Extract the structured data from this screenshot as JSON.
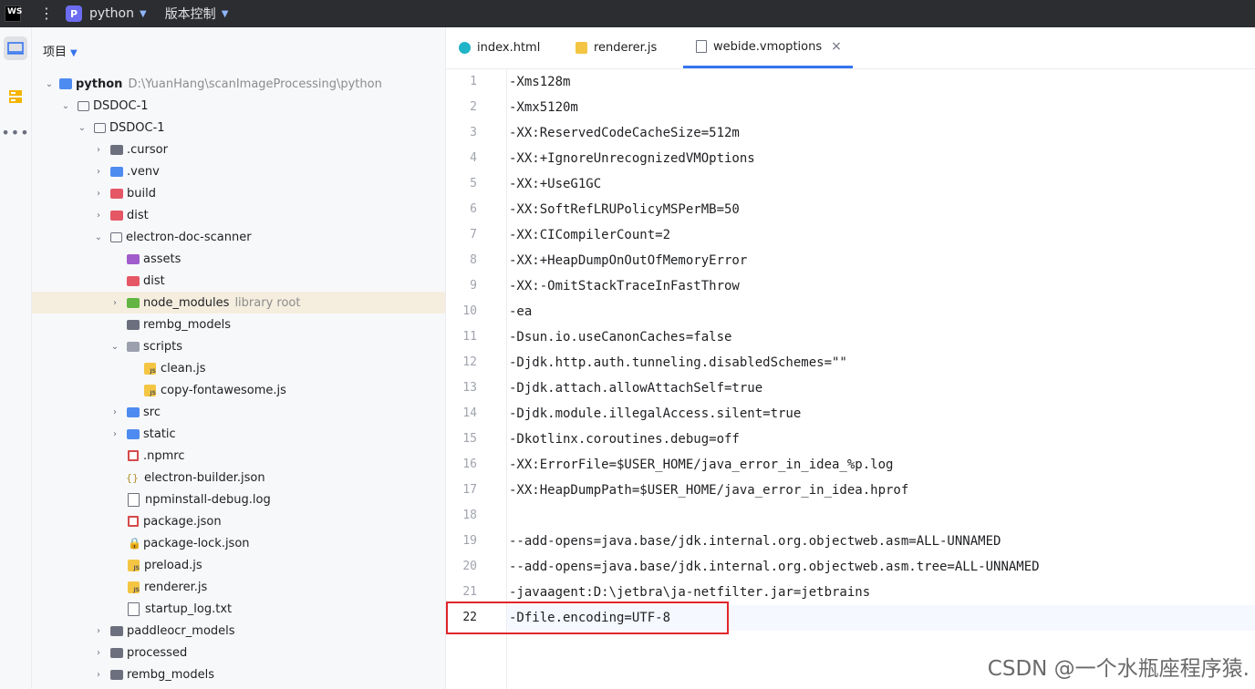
{
  "titlebar": {
    "logo_text": "WS",
    "project_badge": "P",
    "project_name": "python",
    "vcs_label": "版本控制"
  },
  "panel": {
    "title": "项目",
    "tree": [
      {
        "label": "python",
        "hint": "D:\\YuanHang\\scanImageProcessing\\python",
        "bold": true
      },
      {
        "label": "DSDOC-1",
        "hint": ""
      },
      {
        "label": "DSDOC-1",
        "hint": ""
      },
      {
        "label": ".cursor",
        "hint": ""
      },
      {
        "label": ".venv",
        "hint": ""
      },
      {
        "label": "build",
        "hint": ""
      },
      {
        "label": "dist",
        "hint": ""
      },
      {
        "label": "electron-doc-scanner",
        "hint": ""
      },
      {
        "label": "assets",
        "hint": ""
      },
      {
        "label": "dist",
        "hint": ""
      },
      {
        "label": "node_modules",
        "hint": "library root"
      },
      {
        "label": "rembg_models",
        "hint": ""
      },
      {
        "label": "scripts",
        "hint": ""
      },
      {
        "label": "clean.js",
        "hint": ""
      },
      {
        "label": "copy-fontawesome.js",
        "hint": ""
      },
      {
        "label": "src",
        "hint": ""
      },
      {
        "label": "static",
        "hint": ""
      },
      {
        "label": ".npmrc",
        "hint": ""
      },
      {
        "label": "electron-builder.json",
        "hint": ""
      },
      {
        "label": "npminstall-debug.log",
        "hint": ""
      },
      {
        "label": "package.json",
        "hint": ""
      },
      {
        "label": "package-lock.json",
        "hint": ""
      },
      {
        "label": "preload.js",
        "hint": ""
      },
      {
        "label": "renderer.js",
        "hint": ""
      },
      {
        "label": "startup_log.txt",
        "hint": ""
      },
      {
        "label": "paddleocr_models",
        "hint": ""
      },
      {
        "label": "processed",
        "hint": ""
      },
      {
        "label": "rembg_models",
        "hint": ""
      }
    ]
  },
  "tabs": [
    {
      "label": "index.html"
    },
    {
      "label": "renderer.js"
    },
    {
      "label": "webide.vmoptions",
      "close": "×"
    }
  ],
  "editor": {
    "line_numbers": [
      "1",
      "2",
      "3",
      "4",
      "5",
      "6",
      "7",
      "8",
      "9",
      "10",
      "11",
      "12",
      "13",
      "14",
      "15",
      "16",
      "17",
      "18",
      "19",
      "20",
      "21",
      "22"
    ],
    "lines": [
      "-Xms128m",
      "-Xmx5120m",
      "-XX:ReservedCodeCacheSize=512m",
      "-XX:+IgnoreUnrecognizedVMOptions",
      "-XX:+UseG1GC",
      "-XX:SoftRefLRUPolicyMSPerMB=50",
      "-XX:CICompilerCount=2",
      "-XX:+HeapDumpOnOutOfMemoryError",
      "-XX:-OmitStackTraceInFastThrow",
      "-ea",
      "-Dsun.io.useCanonCaches=false",
      "-Djdk.http.auth.tunneling.disabledSchemes=\"\"",
      "-Djdk.attach.allowAttachSelf=true",
      "-Djdk.module.illegalAccess.silent=true",
      "-Dkotlinx.coroutines.debug=off",
      "-XX:ErrorFile=$USER_HOME/java_error_in_idea_%p.log",
      "-XX:HeapDumpPath=$USER_HOME/java_error_in_idea.hprof",
      "",
      "--add-opens=java.base/jdk.internal.org.objectweb.asm=ALL-UNNAMED",
      "--add-opens=java.base/jdk.internal.org.objectweb.asm.tree=ALL-UNNAMED",
      "-javaagent:D:\\jetbra\\ja-netfilter.jar=jetbrains",
      "-Dfile.encoding=UTF-8"
    ]
  },
  "watermark": "CSDN @一个水瓶座程序猿.",
  "colors": {
    "accent": "#3574f0",
    "highlight_box": "#e0262b",
    "selected_row": "#f5eedf"
  }
}
